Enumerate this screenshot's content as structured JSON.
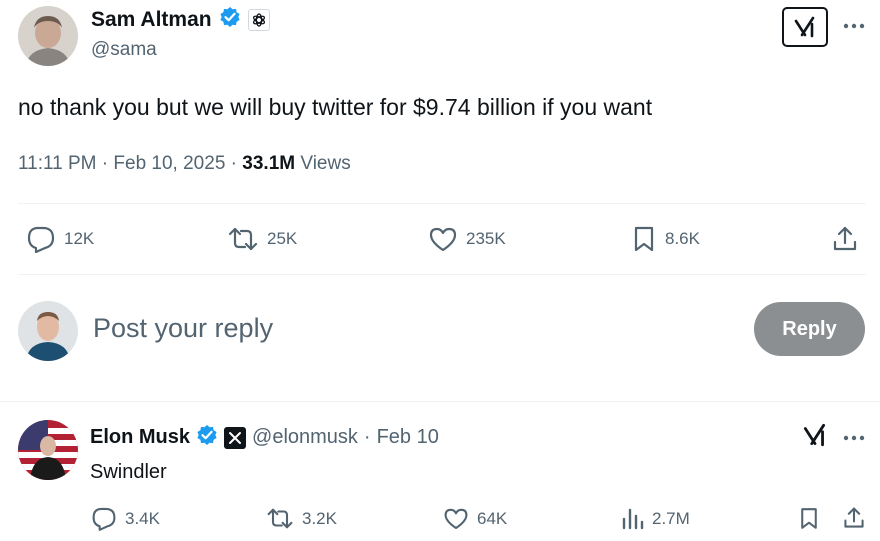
{
  "main_tweet": {
    "author": {
      "name": "Sam Altman",
      "handle": "@sama"
    },
    "text": "no thank you but we will buy twitter for $9.74 billion if you want",
    "time": "11:11 PM",
    "date": "Feb 10, 2025",
    "views_count": "33.1M",
    "views_label": "Views",
    "actions": {
      "replies": "12K",
      "reposts": "25K",
      "likes": "235K",
      "bookmarks": "8.6K"
    }
  },
  "reply_box": {
    "placeholder": "Post your reply",
    "button_label": "Reply"
  },
  "reply_tweet": {
    "author": {
      "name": "Elon Musk",
      "handle": "@elonmusk"
    },
    "date": "Feb 10",
    "text": "Swindler",
    "actions": {
      "replies": "3.4K",
      "reposts": "3.2K",
      "likes": "64K",
      "views": "2.7M"
    }
  },
  "icons": [
    "verified-badge-icon",
    "openai-affiliate-icon",
    "grok-icon",
    "more-icon",
    "reply-icon",
    "repost-icon",
    "like-icon",
    "bookmark-icon",
    "share-icon",
    "views-icon",
    "x-affiliate-icon"
  ],
  "colors": {
    "verified": "#1d9bf0",
    "text": "#0f1419",
    "muted": "#536471",
    "reply_button": "#8b8f92",
    "divider": "#eff3f4"
  }
}
